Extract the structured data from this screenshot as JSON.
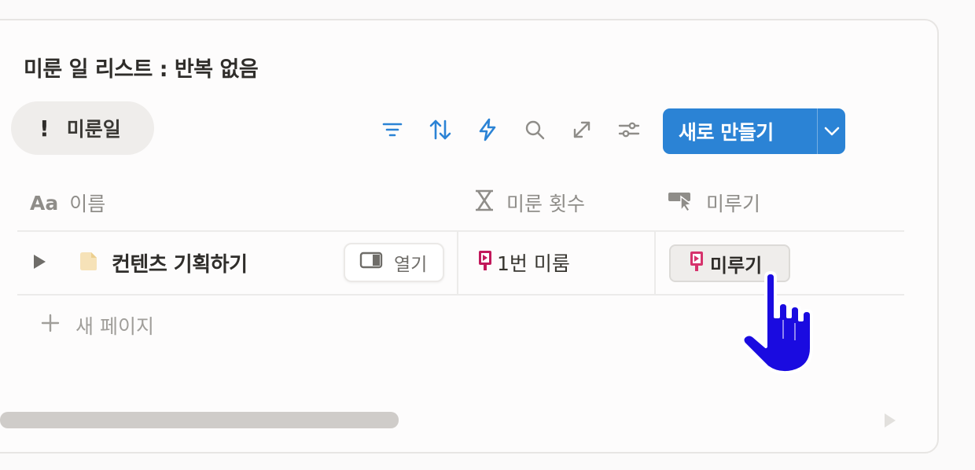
{
  "database": {
    "title": "미룬 일 리스트 : 반복 없음",
    "view_tab": {
      "icon_text": "!",
      "label": "미룬일"
    }
  },
  "toolbar": {
    "icons": [
      "filter-icon",
      "sort-icon",
      "automation-icon",
      "search-icon",
      "expand-icon",
      "settings-icon"
    ],
    "new_button_label": "새로 만들기",
    "accent_color": "#2b83d5"
  },
  "table": {
    "columns": [
      {
        "icon": "Aa",
        "label": "이름"
      },
      {
        "icon": "hourglass-icon",
        "label": "미룬 횟수"
      },
      {
        "icon": "button-cursor-icon",
        "label": "미루기"
      }
    ],
    "rows": [
      {
        "name": "컨텐츠 기획하기",
        "open_label": "열기",
        "defer_count": "1번 미룸",
        "defer_button": "미루기"
      }
    ],
    "new_page_label": "새 페이지"
  }
}
